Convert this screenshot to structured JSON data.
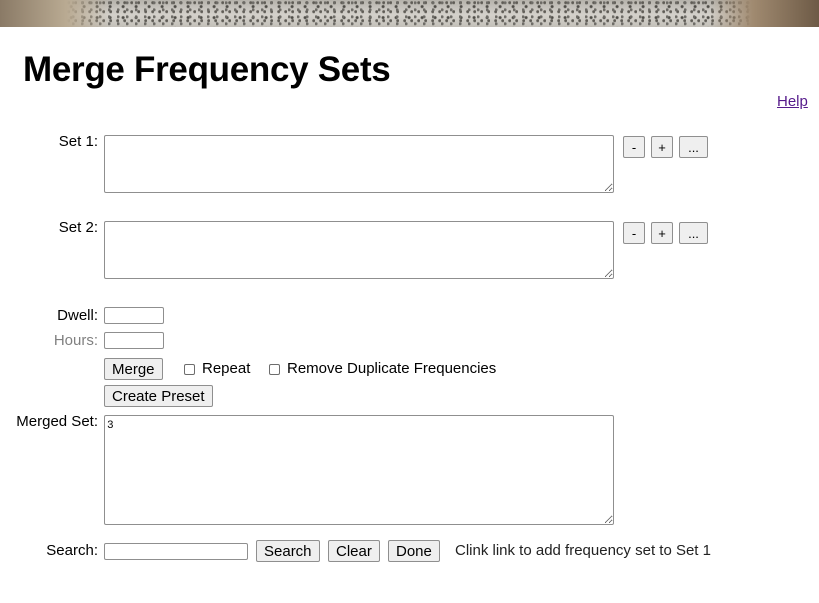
{
  "page": {
    "title": "Merge Frequency Sets",
    "help_link": "Help"
  },
  "set1": {
    "label": "Set 1:",
    "value": ""
  },
  "set2": {
    "label": "Set 2:",
    "value": ""
  },
  "set_buttons": {
    "minus": "-",
    "plus": "+",
    "more": "..."
  },
  "dwell": {
    "label": "Dwell:",
    "value": ""
  },
  "hours": {
    "label": "Hours:",
    "value": ""
  },
  "actions": {
    "merge": "Merge",
    "repeat": "Repeat",
    "remove_duplicates": "Remove Duplicate Frequencies",
    "create_preset": "Create Preset",
    "repeat_checked": false,
    "remove_duplicates_checked": false
  },
  "merged": {
    "label": "Merged Set:",
    "value": "3"
  },
  "search": {
    "label": "Search:",
    "value": "",
    "search_button": "Search",
    "clear_button": "Clear",
    "done_button": "Done",
    "hint": "Clink link to add frequency set to Set 1"
  }
}
